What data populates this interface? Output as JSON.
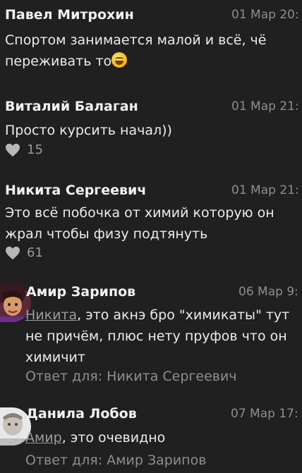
{
  "comments": [
    {
      "author": "Павел Митрохин",
      "date": "01 Мар 20:",
      "text": "Спортом занимается малой и всё, чё переживать то",
      "emoji": "joy-emoji"
    },
    {
      "author": "Виталий Балаган",
      "date": "01 Мар 21:",
      "text": "Просто курсить начал))",
      "likes": "15"
    },
    {
      "author": "Никита Сергеевич",
      "date": "01 Мар 21:",
      "text": "Это всё побочка от химий которую он жрал чтобы  физу подтянуть",
      "likes": "61"
    },
    {
      "author": "Амир Зарипов",
      "date": "06 Мар 9:",
      "mention": "Никита",
      "text": ", это акнэ бро \"химикаты\" тут не причём, плюс нету пруфов что он химичит",
      "reply_to": "Ответ для: Никита Сергеевич"
    },
    {
      "author": "Данила Лобов",
      "date": "07 Мар 17:",
      "mention": "Амир",
      "text": ", это очевидно",
      "reply_to": "Ответ для: Амир Зарипов"
    }
  ],
  "colors": {
    "background": "#202020",
    "text": "#ececec",
    "muted": "#8e8e8e"
  }
}
